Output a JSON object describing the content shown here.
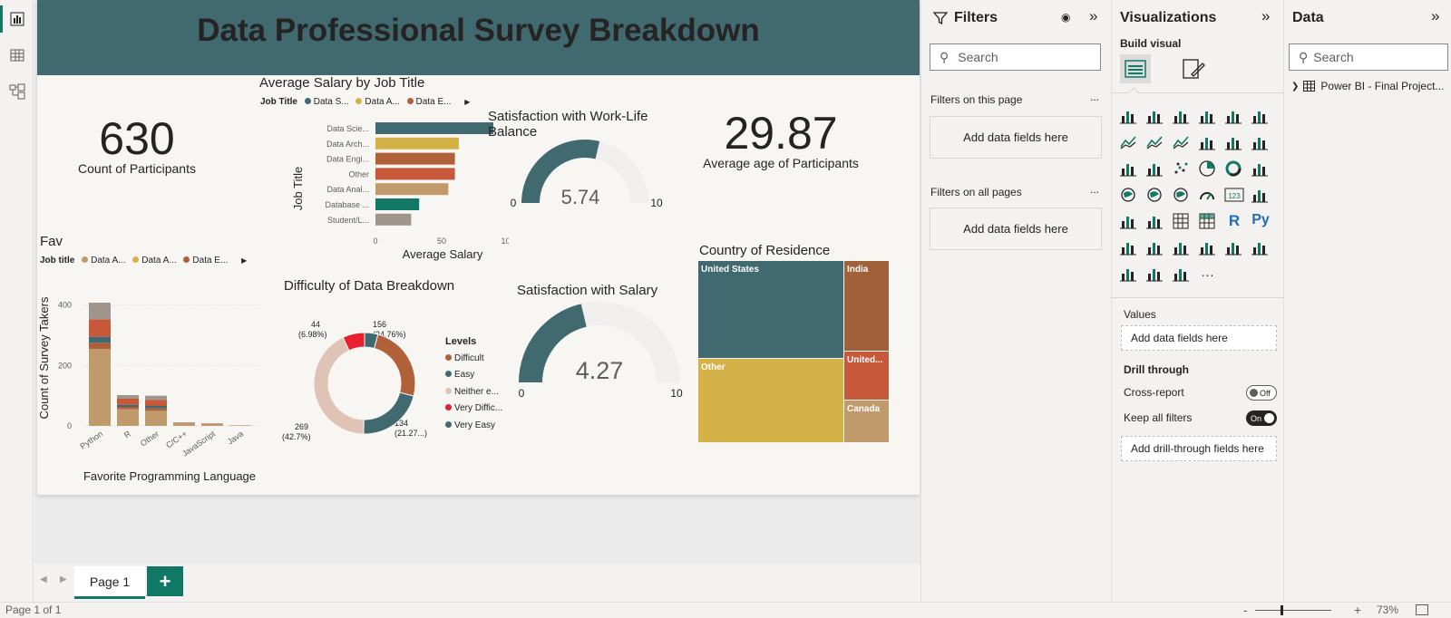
{
  "report": {
    "title": "Data Professional Survey Breakdown",
    "kpi_participants": {
      "value": "630",
      "caption": "Count of Participants"
    },
    "kpi_age": {
      "value": "29.87",
      "caption": "Average age of Participants"
    }
  },
  "salary_chart": {
    "title": "Average Salary by Job Title",
    "legend_label": "Job Title",
    "legend_items": [
      "Data S...",
      "Data A...",
      "Data E..."
    ],
    "legend_colors": [
      "#416970",
      "#d4b248",
      "#b0613a"
    ],
    "ylabel": "Job Title",
    "xlabel": "Average Salary",
    "ticks": [
      "0",
      "50",
      "100"
    ]
  },
  "fav_chart": {
    "title": "Fav",
    "legend_label": "Job title",
    "legend_items": [
      "Data A...",
      "Data A...",
      "Data E..."
    ],
    "legend_colors": [
      "#c19a6b",
      "#d4b248",
      "#b0613a"
    ],
    "ylabel": "Count of Survey Takers",
    "xlabel": "Favorite Programming Language",
    "yticks": [
      "0",
      "200",
      "400"
    ]
  },
  "gauge_worklife": {
    "title": "Satisfaction with Work-Life Balance",
    "value": "5.74",
    "min": "0",
    "max": "10"
  },
  "gauge_salary": {
    "title": "Satisfaction with Salary",
    "value": "4.27",
    "min": "0",
    "max": "10"
  },
  "donut": {
    "title": "Difficulty of Data Breakdown",
    "legend_title": "Levels",
    "legend": [
      "Difficult",
      "Easy",
      "Neither e...",
      "Very Diffic...",
      "Very Easy"
    ],
    "labels": {
      "a1": "156",
      "a2": "(24.76%)",
      "b1": "134",
      "b2": "(21.27...)",
      "c1": "269",
      "c2": "(42.7%)",
      "d1": "44",
      "d2": "(6.98%)"
    }
  },
  "treemap": {
    "title": "Country of Residence",
    "labels": [
      "United States",
      "India",
      "Other",
      "United...",
      "Canada"
    ]
  },
  "chart_data": [
    {
      "type": "bar",
      "title": "Average Salary by Job Title",
      "orientation": "horizontal",
      "categories": [
        "Data Scie...",
        "Data Arch...",
        "Data Engi...",
        "Other",
        "Data Anal...",
        "Database ...",
        "Student/L..."
      ],
      "values": [
        89,
        63,
        60,
        60,
        55,
        33,
        27
      ],
      "colors": [
        "#416970",
        "#d4b248",
        "#b0613a",
        "#c7583a",
        "#c19a6b",
        "#117865",
        "#a0958d"
      ],
      "xlabel": "Average Salary",
      "ylabel": "Job Title",
      "xlim": [
        0,
        100
      ]
    },
    {
      "type": "bar",
      "stacked": true,
      "title": "Fav",
      "categories": [
        "Python",
        "R",
        "Other",
        "C/C++",
        "JavaScript",
        "Java"
      ],
      "series": [
        {
          "name": "Data A...",
          "color": "#c19a6b",
          "values": [
            255,
            55,
            50,
            8,
            5,
            2
          ]
        },
        {
          "name": "Data E...",
          "color": "#b0613a",
          "values": [
            20,
            8,
            8,
            1,
            1,
            0
          ]
        },
        {
          "name": "",
          "color": "#416970",
          "values": [
            20,
            7,
            8,
            1,
            1,
            0
          ]
        },
        {
          "name": "",
          "color": "#c7583a",
          "values": [
            58,
            20,
            20,
            1,
            1,
            0
          ]
        },
        {
          "name": "",
          "color": "#a0958d",
          "values": [
            55,
            12,
            14,
            0,
            0,
            0
          ]
        }
      ],
      "xlabel": "Favorite Programming Language",
      "ylabel": "Count of Survey Takers",
      "ylim": [
        0,
        450
      ]
    },
    {
      "type": "pie",
      "donut": true,
      "title": "Difficulty of Data Breakdown",
      "categories": [
        "Difficult",
        "Easy",
        "Neither e...",
        "Very Diffic...",
        "Very Easy"
      ],
      "values": [
        156,
        134,
        269,
        44,
        27
      ],
      "colors": [
        "#b0613a",
        "#416970",
        "#dfc3b4",
        "#e8202f",
        "#416970"
      ]
    },
    {
      "type": "gauge",
      "title": "Satisfaction with Work-Life Balance",
      "value": 5.74,
      "min": 0,
      "max": 10
    },
    {
      "type": "gauge",
      "title": "Satisfaction with Salary",
      "value": 4.27,
      "min": 0,
      "max": 10
    },
    {
      "type": "treemap",
      "title": "Country of Residence",
      "categories": [
        "United States",
        "Other",
        "India",
        "United...",
        "Canada"
      ],
      "values": [
        260,
        220,
        65,
        35,
        30
      ],
      "colors": [
        "#416970",
        "#d4b248",
        "#a0603a",
        "#c7583a",
        "#c19a6b"
      ]
    }
  ],
  "tabs": {
    "page1": "Page 1",
    "add": "+"
  },
  "status": {
    "page": "Page 1 of 1",
    "zoom": "73%",
    "minus": "-",
    "plus": "+"
  },
  "filters": {
    "title": "Filters",
    "search": "Search",
    "this_page": "Filters on this page",
    "all_pages": "Filters on all pages",
    "add_fields": "Add data fields here",
    "more": "..."
  },
  "viz": {
    "title": "Visualizations",
    "build": "Build visual",
    "values": "Values",
    "add_fields": "Add data fields here",
    "drill": "Drill through",
    "cross": "Cross-report",
    "cross_state": "Off",
    "keep": "Keep all filters",
    "keep_state": "On",
    "add_drill": "Add drill-through fields here",
    "r_label": "R",
    "py_label": "Py",
    "more": "..."
  },
  "data_pane": {
    "title": "Data",
    "search": "Search",
    "table": "Power BI - Final Project..."
  }
}
